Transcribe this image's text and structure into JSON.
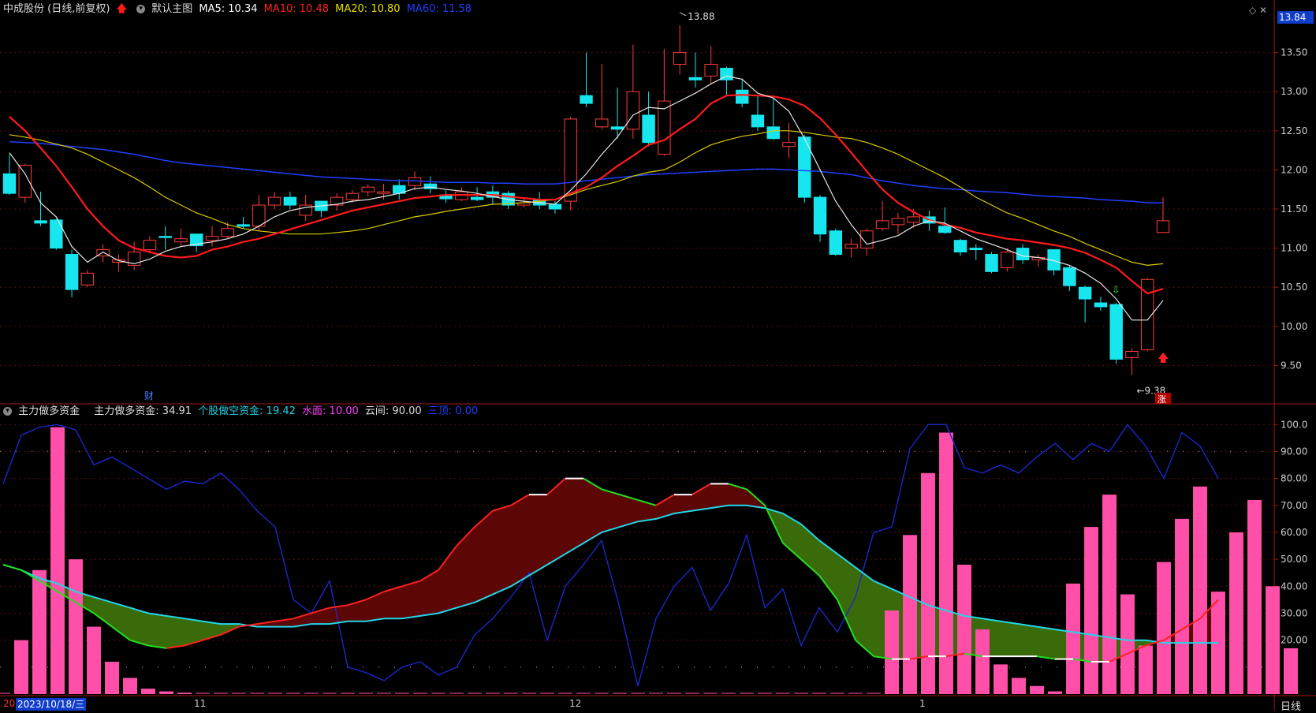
{
  "top_header": {
    "stock_title": "中成股份 (日线,前复权)",
    "main_chart_label": "默认主图",
    "ma5": "MA5: 10.34",
    "ma10": "MA10: 10.48",
    "ma20": "MA20: 10.80",
    "ma60": "MA60: 11.58",
    "colors": {
      "ma5": "#ffffff",
      "ma10": "#ff2020",
      "ma20": "#e8e000",
      "ma60": "#1f3fff"
    }
  },
  "price_tag": "13.84",
  "corner_icons": "◇ ✕",
  "indicator_header": {
    "name": "主力做多资金",
    "main_long": "主力做多资金: 34.91",
    "retail_short": "个股做空资金: 19.42",
    "water_level": "水面: 10.00",
    "cloud": "云间: 90.00",
    "top": "三顶: 0.00",
    "colors": {
      "main_long": "#dddddd",
      "retail_short": "#22d0e0",
      "water_level": "#ff40ff",
      "cloud": "#dddddd",
      "top": "#1f3fff"
    }
  },
  "annotations": {
    "high_label": "13.88",
    "low_label": "9.38",
    "finance_marker": "财",
    "rise_marker": "涨"
  },
  "footer": {
    "date": "2023/10/18/三",
    "left_stub": "20",
    "months": [
      "11",
      "12",
      "1"
    ],
    "period": "日线"
  },
  "price_axis": [
    "13.50",
    "13.00",
    "12.50",
    "12.00",
    "11.50",
    "11.00",
    "10.50",
    "10.00",
    "9.50"
  ],
  "indicator_axis": [
    "100.0",
    "90.00",
    "80.00",
    "70.00",
    "60.00",
    "50.00",
    "40.00",
    "30.00",
    "20.00"
  ],
  "chart_data": {
    "type": "candlestick",
    "price_range": [
      9.05,
      13.95
    ],
    "indicator_range": [
      0,
      103
    ],
    "candles": [
      [
        11.95,
        11.7,
        12.2,
        11.68
      ],
      [
        11.65,
        12.06,
        12.08,
        11.58
      ],
      [
        11.35,
        11.32,
        11.72,
        11.28
      ],
      [
        11.36,
        11.0,
        11.38,
        10.98
      ],
      [
        10.92,
        10.47,
        10.98,
        10.37
      ],
      [
        10.53,
        10.68,
        10.72,
        10.5
      ],
      [
        10.9,
        10.98,
        11.05,
        10.82
      ],
      [
        10.82,
        10.85,
        10.92,
        10.7
      ],
      [
        10.78,
        10.95,
        11.08,
        10.72
      ],
      [
        10.98,
        11.1,
        11.15,
        10.93
      ],
      [
        11.15,
        11.14,
        11.28,
        10.98
      ],
      [
        11.08,
        11.12,
        11.25,
        11.02
      ],
      [
        11.18,
        11.03,
        11.18,
        10.95
      ],
      [
        11.1,
        11.15,
        11.28,
        11.02
      ],
      [
        11.15,
        11.25,
        11.33,
        11.12
      ],
      [
        11.3,
        11.28,
        11.4,
        11.25
      ],
      [
        11.28,
        11.55,
        11.68,
        11.22
      ],
      [
        11.55,
        11.65,
        11.72,
        11.5
      ],
      [
        11.65,
        11.55,
        11.72,
        11.5
      ],
      [
        11.42,
        11.55,
        11.68,
        11.35
      ],
      [
        11.6,
        11.48,
        11.6,
        11.4
      ],
      [
        11.55,
        11.65,
        11.7,
        11.48
      ],
      [
        11.62,
        11.7,
        11.74,
        11.58
      ],
      [
        11.72,
        11.78,
        11.82,
        11.66
      ],
      [
        11.7,
        11.72,
        11.82,
        11.62
      ],
      [
        11.8,
        11.7,
        11.88,
        11.62
      ],
      [
        11.8,
        11.9,
        11.98,
        11.74
      ],
      [
        11.82,
        11.76,
        11.92,
        11.7
      ],
      [
        11.68,
        11.63,
        11.74,
        11.58
      ],
      [
        11.62,
        11.72,
        11.78,
        11.6
      ],
      [
        11.65,
        11.62,
        11.78,
        11.6
      ],
      [
        11.72,
        11.65,
        11.8,
        11.56
      ],
      [
        11.7,
        11.55,
        11.73,
        11.5
      ],
      [
        11.55,
        11.58,
        11.65,
        11.52
      ],
      [
        11.62,
        11.55,
        11.72,
        11.5
      ],
      [
        11.56,
        11.5,
        11.6,
        11.44
      ],
      [
        11.6,
        12.65,
        12.68,
        11.48
      ],
      [
        12.95,
        12.85,
        13.5,
        12.8
      ],
      [
        12.55,
        12.65,
        13.35,
        12.52
      ],
      [
        12.55,
        12.52,
        13.05,
        12.4
      ],
      [
        12.52,
        13.0,
        13.6,
        12.4
      ],
      [
        12.7,
        12.35,
        13.0,
        12.3
      ],
      [
        12.2,
        12.88,
        13.55,
        12.18
      ],
      [
        13.35,
        13.5,
        13.85,
        13.22
      ],
      [
        13.18,
        13.15,
        13.5,
        13.05
      ],
      [
        13.2,
        13.35,
        13.58,
        13.1
      ],
      [
        13.3,
        13.15,
        13.32,
        12.96
      ],
      [
        13.02,
        12.85,
        13.15,
        12.8
      ],
      [
        12.7,
        12.55,
        12.95,
        12.5
      ],
      [
        12.55,
        12.4,
        12.92,
        12.38
      ],
      [
        12.3,
        12.35,
        12.6,
        12.15
      ],
      [
        12.42,
        11.65,
        12.45,
        11.58
      ],
      [
        11.65,
        11.18,
        11.68,
        11.08
      ],
      [
        11.22,
        10.92,
        11.25,
        10.9
      ],
      [
        11.0,
        11.05,
        11.12,
        10.88
      ],
      [
        11.0,
        11.22,
        11.25,
        10.9
      ],
      [
        11.25,
        11.35,
        11.6,
        11.22
      ],
      [
        11.3,
        11.38,
        11.45,
        11.18
      ],
      [
        11.33,
        11.4,
        11.5,
        11.26
      ],
      [
        11.4,
        11.32,
        11.48,
        11.22
      ],
      [
        11.28,
        11.2,
        11.52,
        11.18
      ],
      [
        11.1,
        10.95,
        11.12,
        10.9
      ],
      [
        11.0,
        10.98,
        11.05,
        10.85
      ],
      [
        10.92,
        10.7,
        10.95,
        10.68
      ],
      [
        10.75,
        10.95,
        11.0,
        10.7
      ],
      [
        11.0,
        10.85,
        11.05,
        10.8
      ],
      [
        10.85,
        10.88,
        10.92,
        10.76
      ],
      [
        10.98,
        10.72,
        10.98,
        10.65
      ],
      [
        10.75,
        10.52,
        10.78,
        10.45
      ],
      [
        10.5,
        10.35,
        10.52,
        10.05
      ],
      [
        10.3,
        10.25,
        10.38,
        10.2
      ],
      [
        10.28,
        9.58,
        10.3,
        9.52
      ],
      [
        9.6,
        9.68,
        9.72,
        9.38
      ],
      [
        9.7,
        10.6,
        10.62,
        9.68
      ],
      [
        11.2,
        11.35,
        11.65,
        11.22
      ]
    ],
    "ma5": [
      12.22,
      11.95,
      11.58,
      11.4,
      11.02,
      10.82,
      10.95,
      10.84,
      10.8,
      10.86,
      10.96,
      11.02,
      11.05,
      11.08,
      11.12,
      11.18,
      11.28,
      11.4,
      11.48,
      11.52,
      11.54,
      11.56,
      11.6,
      11.62,
      11.66,
      11.7,
      11.76,
      11.78,
      11.75,
      11.73,
      11.7,
      11.66,
      11.62,
      11.6,
      11.58,
      11.56,
      11.74,
      11.95,
      12.2,
      12.42,
      12.7,
      12.8,
      12.78,
      12.88,
      12.98,
      13.1,
      13.2,
      13.16,
      12.98,
      12.92,
      12.75,
      12.4,
      12.0,
      11.6,
      11.3,
      11.05,
      11.1,
      11.16,
      11.28,
      11.35,
      11.32,
      11.22,
      11.12,
      11.05,
      10.98,
      10.9,
      10.88,
      10.84,
      10.78,
      10.68,
      10.55,
      10.35,
      10.08,
      10.08,
      10.33
    ],
    "ma10": [
      12.68,
      12.5,
      12.28,
      12.05,
      11.78,
      11.5,
      11.28,
      11.1,
      11.0,
      10.95,
      10.9,
      10.88,
      10.9,
      10.98,
      11.02,
      11.08,
      11.12,
      11.18,
      11.24,
      11.3,
      11.36,
      11.42,
      11.48,
      11.52,
      11.56,
      11.6,
      11.64,
      11.66,
      11.68,
      11.68,
      11.68,
      11.68,
      11.66,
      11.64,
      11.62,
      11.62,
      11.7,
      11.78,
      11.9,
      12.05,
      12.18,
      12.32,
      12.38,
      12.52,
      12.65,
      12.85,
      12.95,
      12.96,
      12.95,
      12.94,
      12.9,
      12.82,
      12.66,
      12.45,
      12.22,
      11.98,
      11.75,
      11.58,
      11.46,
      11.36,
      11.3,
      11.26,
      11.2,
      11.16,
      11.12,
      11.1,
      11.07,
      11.04,
      11.0,
      10.94,
      10.85,
      10.75,
      10.58,
      10.42,
      10.48
    ],
    "ma20": [
      12.45,
      12.42,
      12.38,
      12.33,
      12.28,
      12.2,
      12.1,
      12.0,
      11.9,
      11.78,
      11.65,
      11.55,
      11.45,
      11.38,
      11.3,
      11.25,
      11.22,
      11.2,
      11.18,
      11.18,
      11.18,
      11.2,
      11.22,
      11.25,
      11.3,
      11.35,
      11.4,
      11.43,
      11.47,
      11.5,
      11.53,
      11.56,
      11.57,
      11.58,
      11.6,
      11.62,
      11.68,
      11.75,
      11.8,
      11.85,
      11.92,
      11.97,
      12.0,
      12.1,
      12.22,
      12.32,
      12.38,
      12.43,
      12.46,
      12.5,
      12.5,
      12.48,
      12.45,
      12.42,
      12.4,
      12.35,
      12.28,
      12.2,
      12.1,
      12.0,
      11.9,
      11.78,
      11.65,
      11.55,
      11.45,
      11.38,
      11.3,
      11.22,
      11.15,
      11.06,
      10.98,
      10.9,
      10.82,
      10.78,
      10.8
    ],
    "ma60": [
      12.36,
      12.35,
      12.34,
      12.32,
      12.3,
      12.28,
      12.26,
      12.23,
      12.2,
      12.16,
      12.12,
      12.09,
      12.07,
      12.05,
      12.03,
      12.01,
      11.99,
      11.97,
      11.95,
      11.93,
      11.91,
      11.9,
      11.89,
      11.88,
      11.87,
      11.86,
      11.86,
      11.85,
      11.84,
      11.84,
      11.84,
      11.83,
      11.83,
      11.82,
      11.82,
      11.82,
      11.84,
      11.86,
      11.88,
      11.9,
      11.92,
      11.94,
      11.95,
      11.96,
      11.97,
      11.98,
      11.99,
      12.0,
      12.01,
      12.01,
      12.0,
      11.99,
      11.98,
      11.96,
      11.94,
      11.9,
      11.86,
      11.83,
      11.8,
      11.78,
      11.76,
      11.75,
      11.73,
      11.72,
      11.71,
      11.69,
      11.67,
      11.66,
      11.65,
      11.64,
      11.62,
      11.61,
      11.6,
      11.58,
      11.58
    ],
    "ind_long": [
      48,
      46,
      42,
      38,
      34,
      30,
      25,
      20,
      18,
      17,
      18,
      20,
      22,
      25,
      26,
      27,
      28,
      30,
      32,
      33,
      35,
      38,
      40,
      42,
      46,
      55,
      62,
      68,
      70,
      74,
      74,
      80,
      80,
      76,
      74,
      72,
      70,
      74,
      74,
      78,
      78,
      76,
      70,
      56,
      50,
      44,
      35,
      20,
      14,
      13,
      13,
      14,
      14,
      15,
      14,
      14,
      14,
      14,
      13,
      13,
      12,
      12,
      15,
      18,
      20,
      24,
      28,
      35
    ],
    "ind_short": [
      48,
      46,
      43,
      41,
      38,
      36,
      34,
      32,
      30,
      29,
      28,
      27,
      26,
      26,
      25,
      25,
      25,
      26,
      26,
      27,
      27,
      28,
      28,
      29,
      30,
      32,
      34,
      37,
      40,
      44,
      48,
      52,
      56,
      60,
      62,
      64,
      65,
      67,
      68,
      69,
      70,
      70,
      69,
      67,
      63,
      57,
      52,
      47,
      42,
      39,
      36,
      33,
      31,
      29,
      28,
      27,
      26,
      25,
      24,
      23,
      22,
      21,
      20,
      20,
      19,
      19,
      19,
      19
    ],
    "ind_blue": [
      78,
      96,
      99,
      100,
      98,
      85,
      88,
      84,
      80,
      76,
      79,
      78,
      82,
      76,
      68,
      62,
      35,
      30,
      42,
      10,
      8,
      5,
      10,
      12,
      7,
      10,
      22,
      28,
      36,
      45,
      20,
      40,
      48,
      57,
      32,
      3,
      28,
      40,
      47,
      31,
      41,
      59,
      32,
      39,
      18,
      32,
      23,
      36,
      60,
      62,
      91,
      100,
      100,
      84,
      82,
      85,
      82,
      88,
      93,
      87,
      93,
      90,
      100,
      92,
      80,
      97,
      92,
      80
    ],
    "volume_bars": [
      0.4,
      20,
      46,
      99,
      50,
      25,
      12,
      6,
      2,
      1,
      0.5,
      0.3,
      0.2,
      0.2,
      0.1,
      0.1,
      0.1,
      0.1,
      0.1,
      0.1,
      0.1,
      0.1,
      0.1,
      0.1,
      0.1,
      0.1,
      0.1,
      0.1,
      0.1,
      0.1,
      0.1,
      0.1,
      0.1,
      0.1,
      0.1,
      0.1,
      0.1,
      0.1,
      0.1,
      0.1,
      0.1,
      0.1,
      0.1,
      0.1,
      0.1,
      0.1,
      0.1,
      0.1,
      0.1,
      31,
      59,
      82,
      97,
      48,
      24,
      11,
      6,
      3,
      1,
      41,
      62,
      74,
      37,
      18,
      49,
      65,
      77,
      38,
      60,
      72,
      40,
      17
    ]
  }
}
